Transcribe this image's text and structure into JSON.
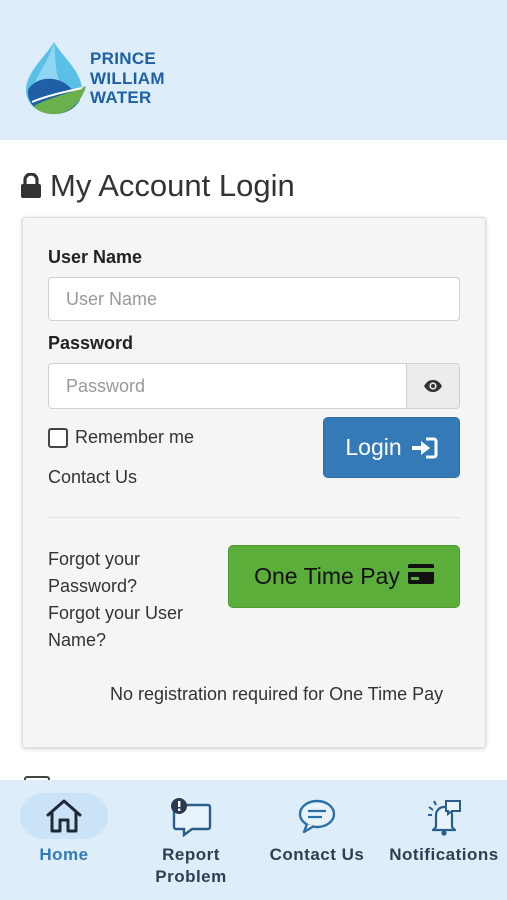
{
  "header": {
    "logo_lines": [
      "PRINCE",
      "WILLIAM",
      "WATER"
    ]
  },
  "page": {
    "title": "My Account Login"
  },
  "form": {
    "username_label": "User Name",
    "username_placeholder": "User Name",
    "password_label": "Password",
    "password_placeholder": "Password",
    "remember_label": "Remember me",
    "contact_link": "Contact Us",
    "login_button": "Login",
    "forgot_password_line1": "Forgot your",
    "forgot_password_line2": "Password?",
    "forgot_username_line1": "Forgot your User",
    "forgot_username_line2": "Name?",
    "one_time_pay_button": "One Time Pay",
    "no_registration_note": "No registration required for One Time Pay"
  },
  "tabs": [
    {
      "label": "Home",
      "icon": "home-icon",
      "active": true
    },
    {
      "label_line1": "Report",
      "label_line2": "Problem",
      "icon": "report-problem-icon"
    },
    {
      "label": "Contact Us",
      "icon": "chat-bubbles-icon"
    },
    {
      "label": "Notifications",
      "icon": "bell-icon"
    }
  ],
  "colors": {
    "header_bg": "#ddeefa",
    "brand_blue": "#1f5fa5",
    "login_button": "#337ab7",
    "pay_button": "#5cae3a",
    "active_tab": "#337ab7"
  }
}
